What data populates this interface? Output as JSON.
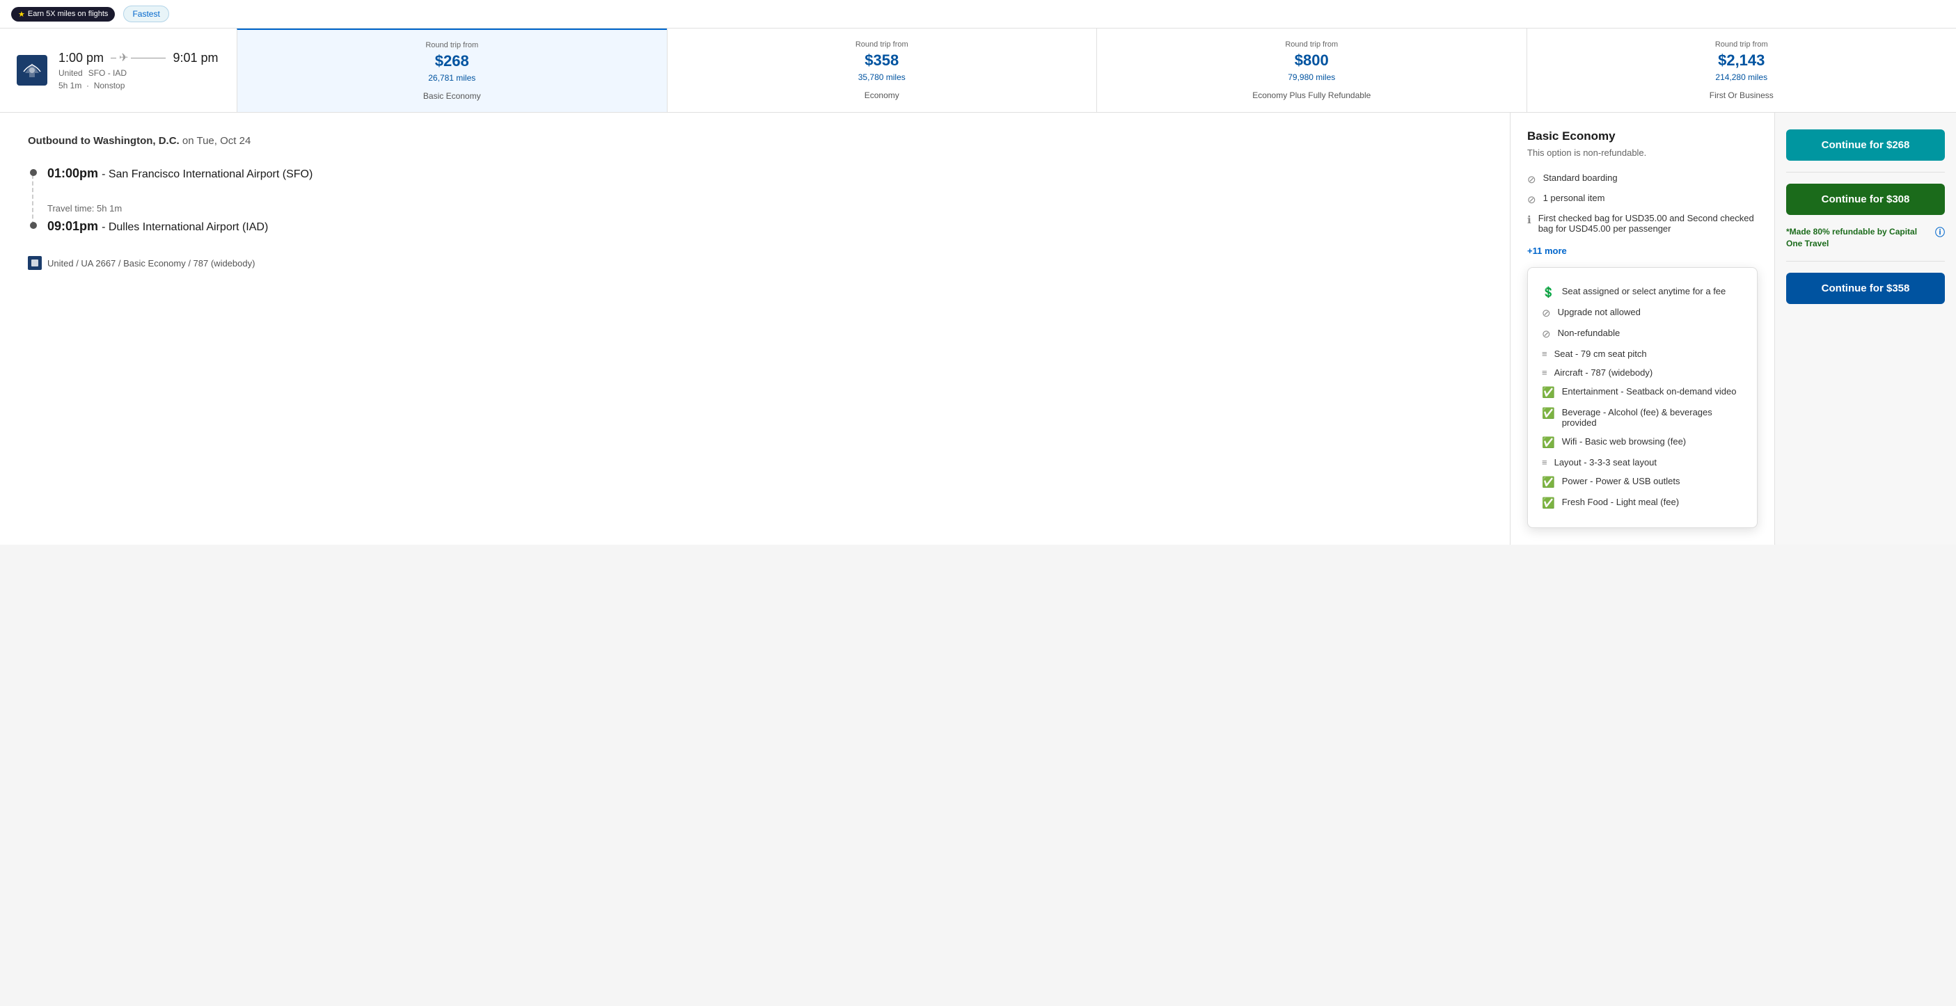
{
  "topBar": {
    "earnBadge": "Earn 5X miles on flights",
    "fastestBadge": "Fastest"
  },
  "flight": {
    "departTime": "1:00 pm",
    "arriveTime": "9:01 pm",
    "airline": "United",
    "route": "SFO - IAD",
    "duration": "5h 1m",
    "stops": "Nonstop"
  },
  "fareOptions": [
    {
      "label": "Round trip from",
      "price": "$268",
      "miles": "26,781 miles",
      "type": "Basic Economy",
      "selected": true
    },
    {
      "label": "Round trip from",
      "price": "$358",
      "miles": "35,780 miles",
      "type": "Economy",
      "selected": false
    },
    {
      "label": "Round trip from",
      "price": "$800",
      "miles": "79,980 miles",
      "type": "Economy Plus Fully Refundable",
      "selected": false
    },
    {
      "label": "Round trip from",
      "price": "$2,143",
      "miles": "214,280 miles",
      "type": "First Or Business",
      "selected": false
    }
  ],
  "itinerary": {
    "outboundLabel": "Outbound to Washington, D.C.",
    "outboundDate": "on Tue, Oct 24",
    "departStop": {
      "time": "01:00pm",
      "airport": "San Francisco International Airport (SFO)"
    },
    "travelTime": "Travel time: 5h 1m",
    "arriveStop": {
      "time": "09:01pm",
      "airport": "Dulles International Airport (IAD)"
    },
    "flightDetails": "United / UA 2667 / Basic Economy / 787 (widebody)"
  },
  "fareDetail": {
    "title": "Basic Economy",
    "subtitle": "This option is non-refundable.",
    "features": [
      {
        "icon": "block",
        "text": "Standard boarding"
      },
      {
        "icon": "block",
        "text": "1 personal item"
      },
      {
        "icon": "info",
        "text": "First checked bag for USD35.00 and Second checked bag for USD45.00 per passenger"
      }
    ],
    "moreLink": "+11 more"
  },
  "popup": {
    "items": [
      {
        "icon": "circle-dollar",
        "text": "Seat assigned or select anytime for a fee"
      },
      {
        "icon": "block",
        "text": "Upgrade not allowed"
      },
      {
        "icon": "block",
        "text": "Non-refundable"
      },
      {
        "icon": "lines",
        "text": "Seat - 79 cm seat pitch"
      },
      {
        "icon": "lines",
        "text": "Aircraft - 787 (widebody)"
      },
      {
        "icon": "green-check",
        "text": "Entertainment - Seatback on-demand video"
      },
      {
        "icon": "green-check",
        "text": "Beverage - Alcohol (fee) & beverages provided"
      },
      {
        "icon": "green-check",
        "text": "Wifi - Basic web browsing (fee)"
      },
      {
        "icon": "lines",
        "text": "Layout - 3-3-3 seat layout"
      },
      {
        "icon": "green-check",
        "text": "Power - Power & USB outlets"
      },
      {
        "icon": "green-check",
        "text": "Fresh Food - Light meal (fee)"
      }
    ]
  },
  "continueButtons": [
    {
      "label": "Continue for $268",
      "style": "teal"
    },
    {
      "label": "Continue for $308",
      "style": "green"
    },
    {
      "label": "Continue for $358",
      "style": "blue"
    }
  ],
  "capitalOneNote": "*Made 80% refundable by Capital One Travel"
}
